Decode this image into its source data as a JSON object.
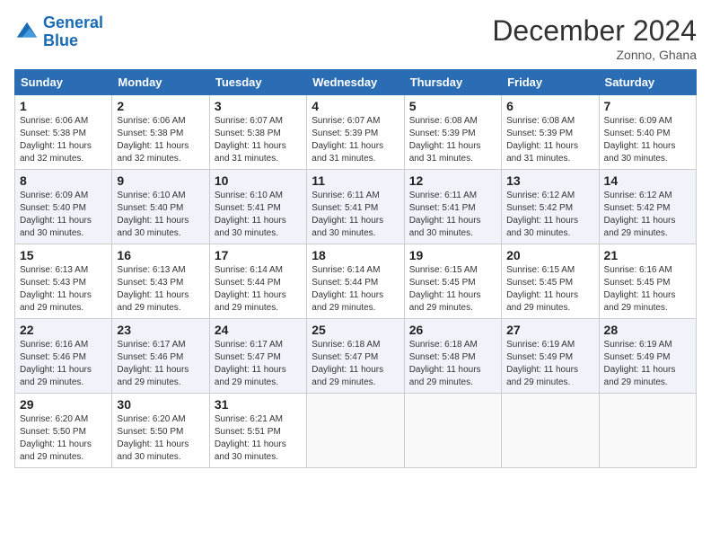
{
  "logo": {
    "text_general": "General",
    "text_blue": "Blue"
  },
  "title": "December 2024",
  "location": "Zonno, Ghana",
  "days_of_week": [
    "Sunday",
    "Monday",
    "Tuesday",
    "Wednesday",
    "Thursday",
    "Friday",
    "Saturday"
  ],
  "weeks": [
    [
      {
        "day": "1",
        "sunrise": "6:06 AM",
        "sunset": "5:38 PM",
        "daylight": "11 hours and 32 minutes."
      },
      {
        "day": "2",
        "sunrise": "6:06 AM",
        "sunset": "5:38 PM",
        "daylight": "11 hours and 32 minutes."
      },
      {
        "day": "3",
        "sunrise": "6:07 AM",
        "sunset": "5:38 PM",
        "daylight": "11 hours and 31 minutes."
      },
      {
        "day": "4",
        "sunrise": "6:07 AM",
        "sunset": "5:39 PM",
        "daylight": "11 hours and 31 minutes."
      },
      {
        "day": "5",
        "sunrise": "6:08 AM",
        "sunset": "5:39 PM",
        "daylight": "11 hours and 31 minutes."
      },
      {
        "day": "6",
        "sunrise": "6:08 AM",
        "sunset": "5:39 PM",
        "daylight": "11 hours and 31 minutes."
      },
      {
        "day": "7",
        "sunrise": "6:09 AM",
        "sunset": "5:40 PM",
        "daylight": "11 hours and 30 minutes."
      }
    ],
    [
      {
        "day": "8",
        "sunrise": "6:09 AM",
        "sunset": "5:40 PM",
        "daylight": "11 hours and 30 minutes."
      },
      {
        "day": "9",
        "sunrise": "6:10 AM",
        "sunset": "5:40 PM",
        "daylight": "11 hours and 30 minutes."
      },
      {
        "day": "10",
        "sunrise": "6:10 AM",
        "sunset": "5:41 PM",
        "daylight": "11 hours and 30 minutes."
      },
      {
        "day": "11",
        "sunrise": "6:11 AM",
        "sunset": "5:41 PM",
        "daylight": "11 hours and 30 minutes."
      },
      {
        "day": "12",
        "sunrise": "6:11 AM",
        "sunset": "5:41 PM",
        "daylight": "11 hours and 30 minutes."
      },
      {
        "day": "13",
        "sunrise": "6:12 AM",
        "sunset": "5:42 PM",
        "daylight": "11 hours and 30 minutes."
      },
      {
        "day": "14",
        "sunrise": "6:12 AM",
        "sunset": "5:42 PM",
        "daylight": "11 hours and 29 minutes."
      }
    ],
    [
      {
        "day": "15",
        "sunrise": "6:13 AM",
        "sunset": "5:43 PM",
        "daylight": "11 hours and 29 minutes."
      },
      {
        "day": "16",
        "sunrise": "6:13 AM",
        "sunset": "5:43 PM",
        "daylight": "11 hours and 29 minutes."
      },
      {
        "day": "17",
        "sunrise": "6:14 AM",
        "sunset": "5:44 PM",
        "daylight": "11 hours and 29 minutes."
      },
      {
        "day": "18",
        "sunrise": "6:14 AM",
        "sunset": "5:44 PM",
        "daylight": "11 hours and 29 minutes."
      },
      {
        "day": "19",
        "sunrise": "6:15 AM",
        "sunset": "5:45 PM",
        "daylight": "11 hours and 29 minutes."
      },
      {
        "day": "20",
        "sunrise": "6:15 AM",
        "sunset": "5:45 PM",
        "daylight": "11 hours and 29 minutes."
      },
      {
        "day": "21",
        "sunrise": "6:16 AM",
        "sunset": "5:45 PM",
        "daylight": "11 hours and 29 minutes."
      }
    ],
    [
      {
        "day": "22",
        "sunrise": "6:16 AM",
        "sunset": "5:46 PM",
        "daylight": "11 hours and 29 minutes."
      },
      {
        "day": "23",
        "sunrise": "6:17 AM",
        "sunset": "5:46 PM",
        "daylight": "11 hours and 29 minutes."
      },
      {
        "day": "24",
        "sunrise": "6:17 AM",
        "sunset": "5:47 PM",
        "daylight": "11 hours and 29 minutes."
      },
      {
        "day": "25",
        "sunrise": "6:18 AM",
        "sunset": "5:47 PM",
        "daylight": "11 hours and 29 minutes."
      },
      {
        "day": "26",
        "sunrise": "6:18 AM",
        "sunset": "5:48 PM",
        "daylight": "11 hours and 29 minutes."
      },
      {
        "day": "27",
        "sunrise": "6:19 AM",
        "sunset": "5:49 PM",
        "daylight": "11 hours and 29 minutes."
      },
      {
        "day": "28",
        "sunrise": "6:19 AM",
        "sunset": "5:49 PM",
        "daylight": "11 hours and 29 minutes."
      }
    ],
    [
      {
        "day": "29",
        "sunrise": "6:20 AM",
        "sunset": "5:50 PM",
        "daylight": "11 hours and 29 minutes."
      },
      {
        "day": "30",
        "sunrise": "6:20 AM",
        "sunset": "5:50 PM",
        "daylight": "11 hours and 30 minutes."
      },
      {
        "day": "31",
        "sunrise": "6:21 AM",
        "sunset": "5:51 PM",
        "daylight": "11 hours and 30 minutes."
      },
      null,
      null,
      null,
      null
    ]
  ]
}
